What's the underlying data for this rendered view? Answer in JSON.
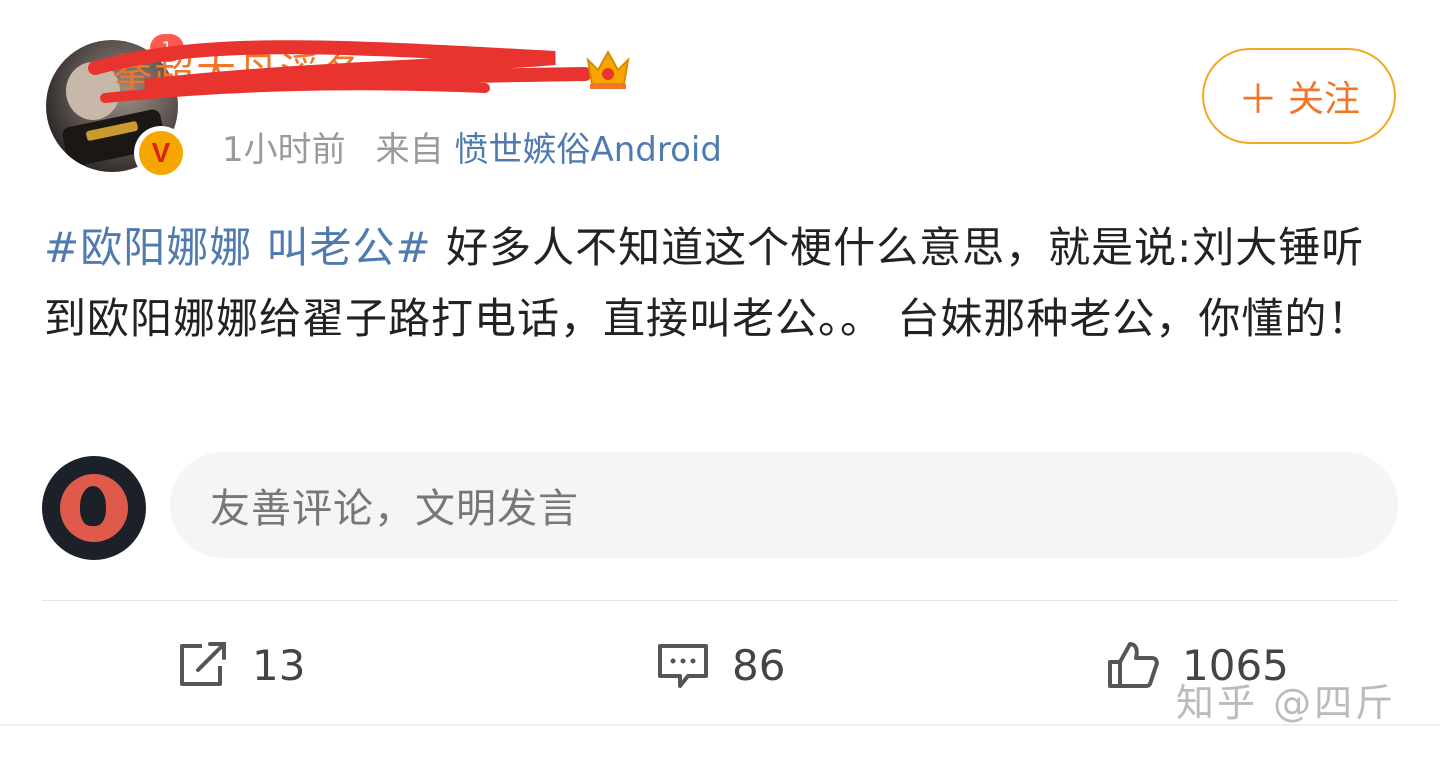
{
  "post": {
    "username": "拳超大丹溪冬",
    "time": "1小时前",
    "source_prefix": "来自",
    "source": "愤世嫉俗Android",
    "follow_label": "关注",
    "hashtag": "#欧阳娜娜 叫老公#",
    "body": " 好多人不知道这个梗什么意思，就是说:刘大锤听到欧阳娜娜给翟子路打电话，直接叫老公。。 台妹那种老公，你懂的！",
    "verified_badge": "V"
  },
  "comment": {
    "placeholder": "友善评论，文明发言"
  },
  "actions": {
    "repost_count": "13",
    "comment_count": "86",
    "like_count": "1065"
  },
  "watermark": "知乎 @四斤",
  "colors": {
    "accent_orange": "#f0762a",
    "follow_border": "#f5a623",
    "link_blue": "#4f7bb0",
    "verified_gold": "#f7a600"
  },
  "icons": [
    "plus-icon",
    "share-icon",
    "comment-icon",
    "like-icon",
    "crown-icon"
  ]
}
